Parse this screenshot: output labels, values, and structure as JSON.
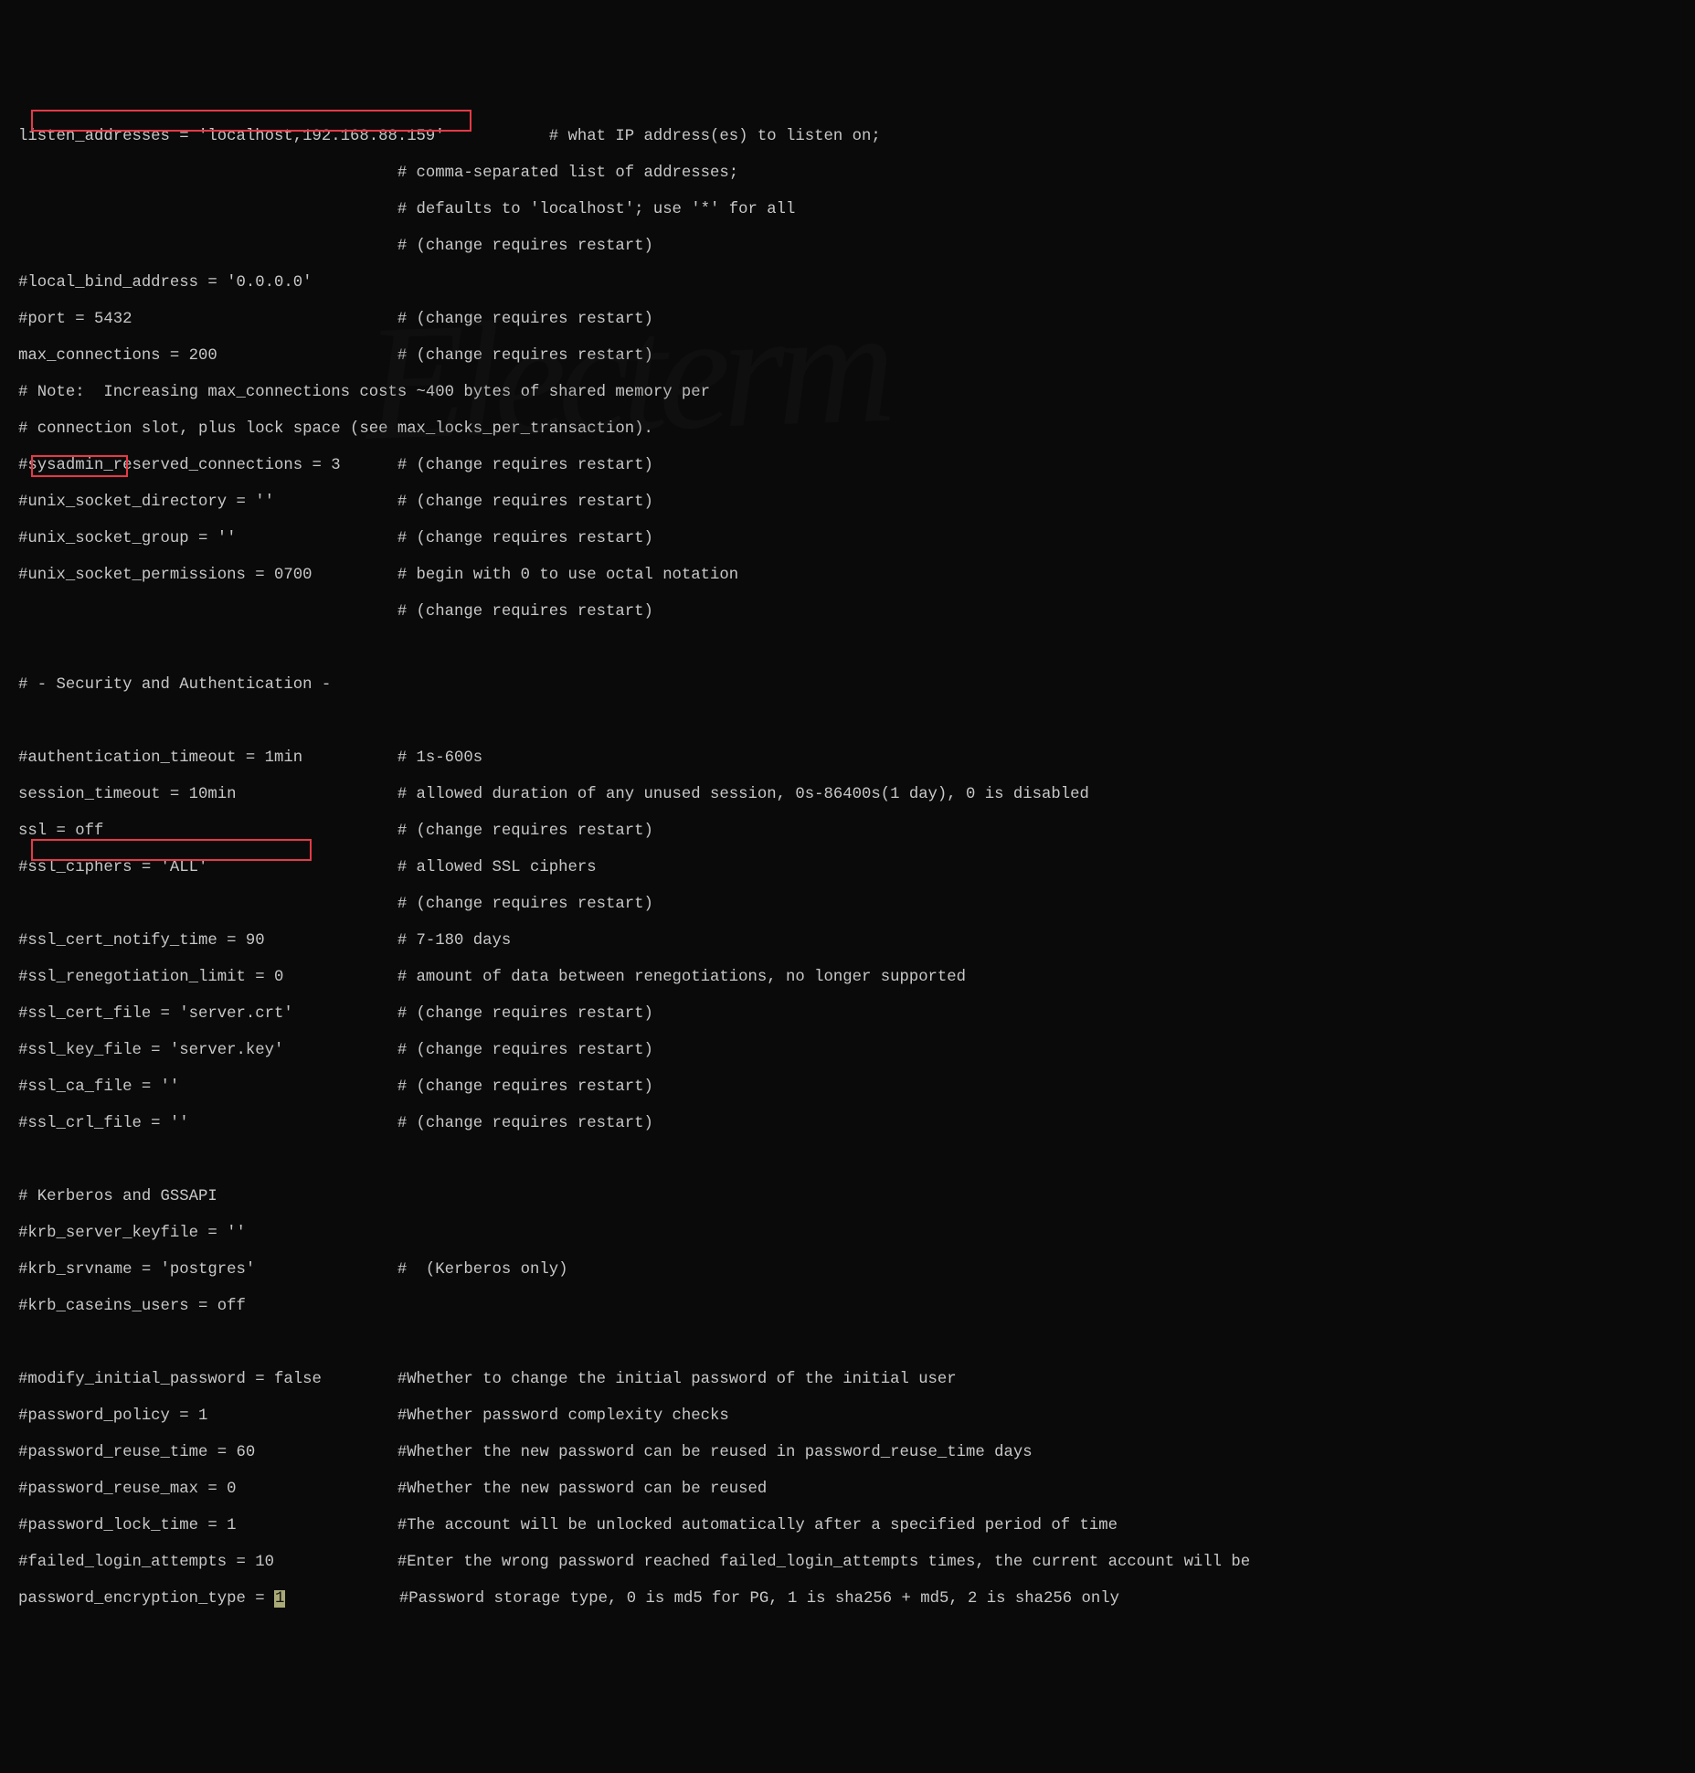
{
  "lines": {
    "l1": "listen_addresses = 'localhost,192.168.88.159'           # what IP address(es) to listen on;",
    "l2": "                                        # comma-separated list of addresses;",
    "l3": "                                        # defaults to 'localhost'; use '*' for all",
    "l4": "                                        # (change requires restart)",
    "l5": "#local_bind_address = '0.0.0.0'",
    "l6": "#port = 5432                            # (change requires restart)",
    "l7": "max_connections = 200                   # (change requires restart)",
    "l8": "# Note:  Increasing max_connections costs ~400 bytes of shared memory per",
    "l9": "# connection slot, plus lock space (see max_locks_per_transaction).",
    "l10": "#sysadmin_reserved_connections = 3      # (change requires restart)",
    "l11": "#unix_socket_directory = ''             # (change requires restart)",
    "l12": "#unix_socket_group = ''                 # (change requires restart)",
    "l13": "#unix_socket_permissions = 0700         # begin with 0 to use octal notation",
    "l14": "                                        # (change requires restart)",
    "l15": "",
    "l16": "# - Security and Authentication -",
    "l17": "",
    "l18": "#authentication_timeout = 1min          # 1s-600s",
    "l19": "session_timeout = 10min                 # allowed duration of any unused session, 0s-86400s(1 day), 0 is disabled",
    "l20": "ssl = off                               # (change requires restart)",
    "l21": "#ssl_ciphers = 'ALL'                    # allowed SSL ciphers",
    "l22": "                                        # (change requires restart)",
    "l23": "#ssl_cert_notify_time = 90              # 7-180 days",
    "l24": "#ssl_renegotiation_limit = 0            # amount of data between renegotiations, no longer supported",
    "l25": "#ssl_cert_file = 'server.crt'           # (change requires restart)",
    "l26": "#ssl_key_file = 'server.key'            # (change requires restart)",
    "l27": "#ssl_ca_file = ''                       # (change requires restart)",
    "l28": "#ssl_crl_file = ''                      # (change requires restart)",
    "l29": "",
    "l30": "# Kerberos and GSSAPI",
    "l31": "#krb_server_keyfile = ''",
    "l32": "#krb_srvname = 'postgres'               #  (Kerberos only)",
    "l33": "#krb_caseins_users = off",
    "l34": "",
    "l35": "#modify_initial_password = false        #Whether to change the initial password of the initial user",
    "l36": "#password_policy = 1                    #Whether password complexity checks",
    "l37": "#password_reuse_time = 60               #Whether the new password can be reused in password_reuse_time days",
    "l38": "#password_reuse_max = 0                 #Whether the new password can be reused",
    "l39": "#password_lock_time = 1                 #The account will be unlocked automatically after a specified period of time",
    "l40": "#failed_login_attempts = 10             #Enter the wrong password reached failed_login_attempts times, the current account will be",
    "l41a": "password_encryption_type = ",
    "l41cursor": "1",
    "l41b": "            #Password storage type, 0 is md5 for PG, 1 is sha256 + md5, 2 is sha256 only"
  },
  "watermark": "Electerm"
}
